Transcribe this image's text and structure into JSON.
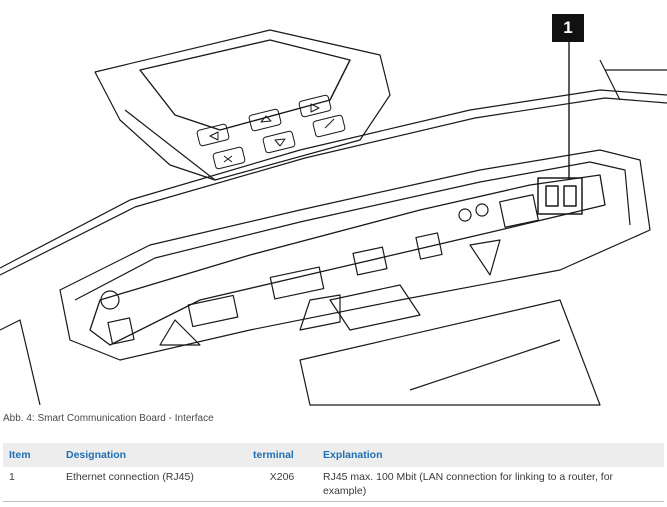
{
  "figure": {
    "callout_number": "1",
    "caption": "Abb. 4: Smart Communication Board - Interface"
  },
  "table": {
    "headers": {
      "item": "Item",
      "designation": "Designation",
      "terminal": "terminal",
      "explanation": "Explanation"
    },
    "rows": [
      {
        "item": "1",
        "designation": "Ethernet connection (RJ45)",
        "terminal": "X206",
        "explanation": "RJ45 max. 100 Mbit (LAN connection for linking to a router, for example)"
      }
    ]
  }
}
